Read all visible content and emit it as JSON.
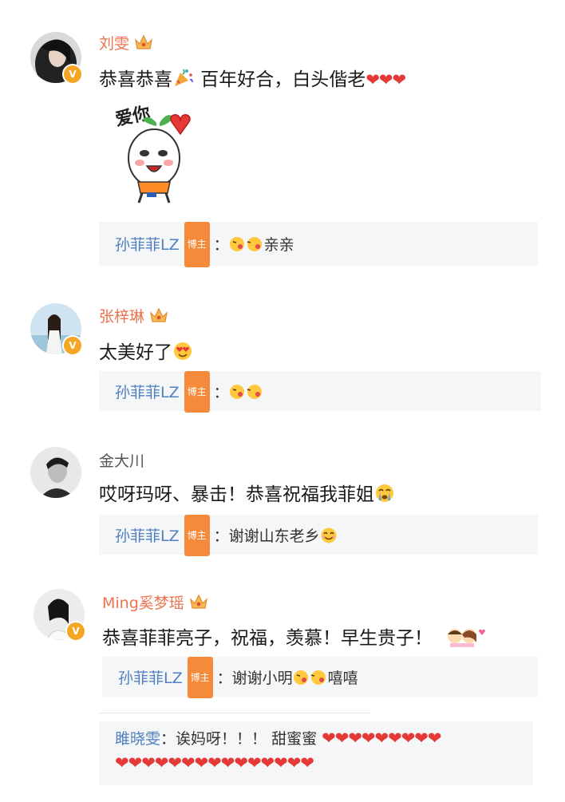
{
  "comments": [
    {
      "name": "刘雯",
      "text": "恭喜恭喜",
      "text2": " 百年好合，白头偕老",
      "reply": {
        "name": "孙菲菲LZ",
        "tag": "博主",
        "sep": "：",
        "text": "亲亲"
      },
      "sticker_text": "爱你"
    },
    {
      "name": "张梓琳",
      "text": "太美好了",
      "reply": {
        "name": "孙菲菲LZ",
        "tag": "博主",
        "sep": "：",
        "text": ""
      }
    },
    {
      "name": "金大川",
      "text": "哎呀玛呀、暴击！恭喜祝福我菲姐",
      "reply": {
        "name": "孙菲菲LZ",
        "tag": "博主",
        "sep": "：",
        "text": "谢谢山东老乡"
      }
    },
    {
      "name": "Ming奚梦瑶",
      "text": "恭喜菲菲亮子，祝福，羡慕！早生贵子！",
      "reply": {
        "name": "孙菲菲LZ",
        "tag": "博主",
        "sep": "：",
        "text": "谢谢小明",
        "text2": "嘻嘻"
      }
    }
  ],
  "extra_reply": {
    "name": "雎晓雯",
    "sep": "：",
    "text": "诶妈呀！！！ 甜蜜蜜"
  },
  "colors": {
    "name": "#eb7350",
    "reply_name": "#4f7fbf",
    "reply_bg": "#f5f6f7",
    "badge": "#f5a623"
  }
}
